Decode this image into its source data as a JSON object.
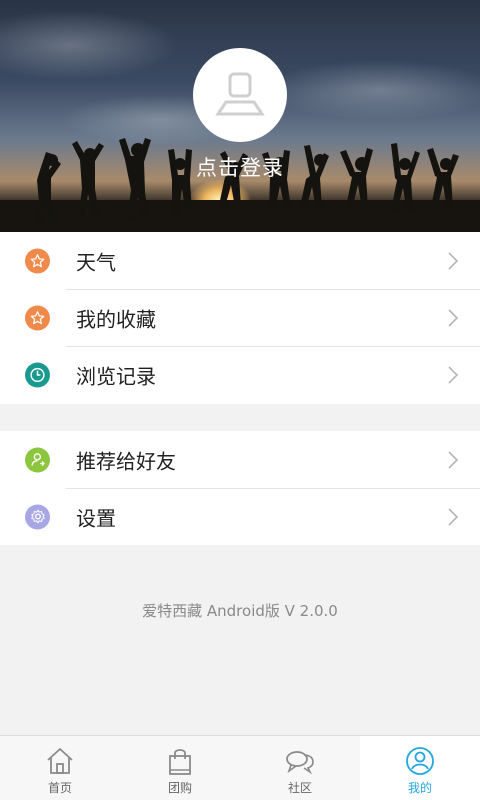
{
  "header": {
    "login_text": "点击登录"
  },
  "menu": {
    "group1": [
      {
        "label": "天气",
        "icon": "star-icon",
        "color": "#f08a4b"
      },
      {
        "label": "我的收藏",
        "icon": "star-icon",
        "color": "#f08a4b"
      },
      {
        "label": "浏览记录",
        "icon": "clock-icon",
        "color": "#1a9a8e"
      }
    ],
    "group2": [
      {
        "label": "推荐给好友",
        "icon": "share-user-icon",
        "color": "#8cc63f"
      },
      {
        "label": "设置",
        "icon": "gear-icon",
        "color": "#a9a6e6"
      }
    ]
  },
  "version": "爱特西藏 Android版 V 2.0.0",
  "tabs": [
    {
      "label": "首页",
      "icon": "home-icon",
      "active": false
    },
    {
      "label": "团购",
      "icon": "shopping-bag-icon",
      "active": false
    },
    {
      "label": "社区",
      "icon": "chat-bubbles-icon",
      "active": false
    },
    {
      "label": "我的",
      "icon": "user-icon",
      "active": true
    }
  ],
  "colors": {
    "accent": "#22a7e0",
    "orange": "#f08a4b",
    "teal": "#1a9a8e",
    "green": "#8cc63f",
    "lavender": "#a9a6e6"
  }
}
